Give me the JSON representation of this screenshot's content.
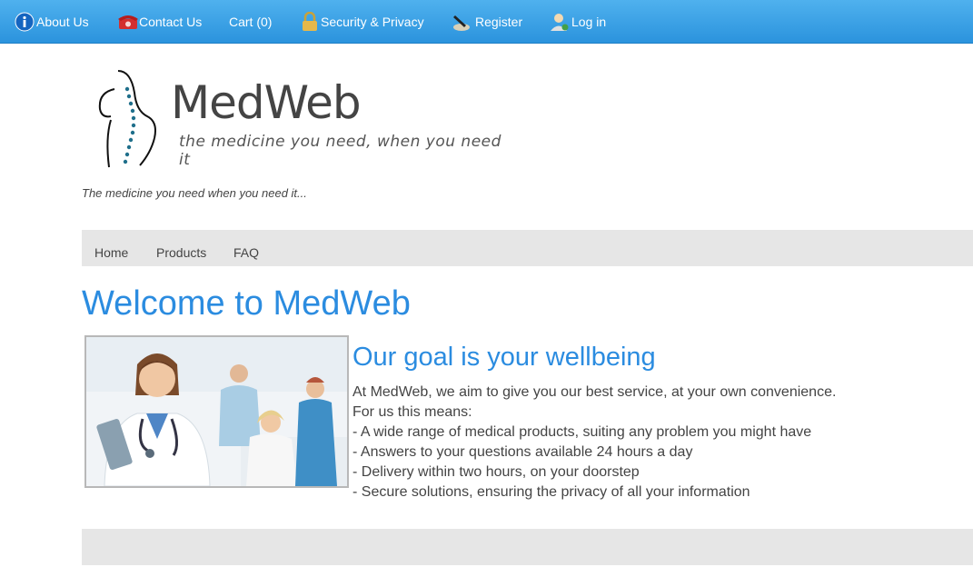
{
  "topbar": {
    "items": [
      {
        "label": "About Us",
        "icon": "info-icon"
      },
      {
        "label": "Contact Us",
        "icon": "phone-icon"
      },
      {
        "label": "Cart (0)",
        "icon": ""
      },
      {
        "label": "Security & Privacy",
        "icon": "lock-icon"
      },
      {
        "label": "Register",
        "icon": "pen-icon"
      },
      {
        "label": "Log in",
        "icon": "user-icon"
      }
    ]
  },
  "logo": {
    "title": "MedWeb",
    "subtitle": "the medicine you need, when you need it"
  },
  "tagline": "The medicine you need when you need it...",
  "nav": {
    "items": [
      "Home",
      "Products",
      "FAQ"
    ]
  },
  "main": {
    "heading": "Welcome to MedWeb",
    "subheading": "Our goal is your wellbeing",
    "lines": [
      "At MedWeb, we aim to give you our best service, at your own convenience.",
      "For us this means:",
      "- A wide range of medical products, suiting any problem you might have",
      "- Answers to your questions available 24 hours a day",
      "- Delivery within two hours, on your doorstep",
      "- Secure solutions, ensuring the privacy of all your information"
    ]
  },
  "colors": {
    "topbar": "#2b93dd",
    "heading": "#2b8ce0",
    "navbar": "#e6e6e6"
  }
}
